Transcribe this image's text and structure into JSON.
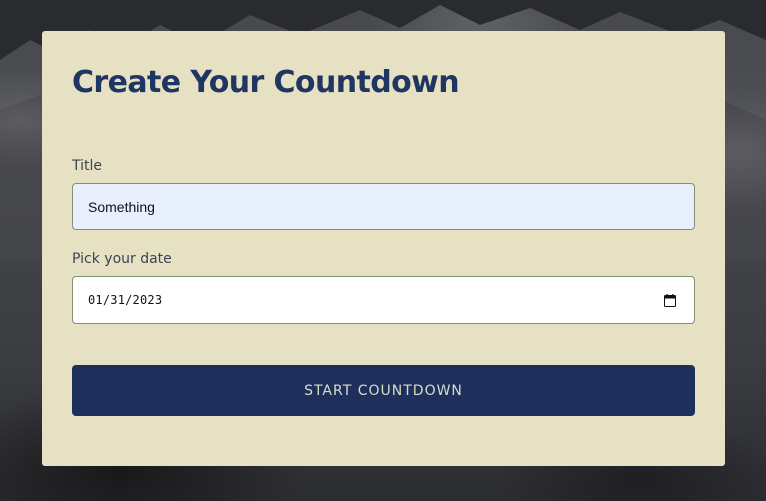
{
  "form": {
    "heading": "Create Your Countdown",
    "title_label": "Title",
    "title_value": "Something",
    "date_label": "Pick your date",
    "date_value": "01/31/2023",
    "submit_label": "START COUNTDOWN"
  },
  "icons": {
    "date_picker": "calendar-icon"
  },
  "colors": {
    "card_background": "#e6e1c2",
    "heading": "#1f3562",
    "button_background": "#1e2f5c",
    "button_text": "#d9dcc8",
    "autofill_background": "#e8f0fe",
    "input_border": "#7f9275"
  }
}
